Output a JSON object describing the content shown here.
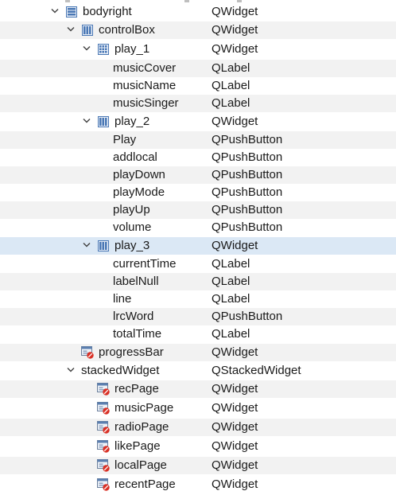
{
  "tree": {
    "rows": [
      {
        "name": "bodyright",
        "cls": "QWidget",
        "level": 0,
        "expander": "expanded",
        "icon": "vertical-layout-icon",
        "alt": false,
        "selected": false
      },
      {
        "name": "controlBox",
        "cls": "QWidget",
        "level": 1,
        "expander": "expanded",
        "icon": "horizontal-layout-icon",
        "alt": true,
        "selected": false
      },
      {
        "name": "play_1",
        "cls": "QWidget",
        "level": 2,
        "expander": "expanded",
        "icon": "grid-layout-icon",
        "alt": false,
        "selected": false
      },
      {
        "name": "musicCover",
        "cls": "QLabel",
        "level": 3,
        "expander": "none",
        "icon": "",
        "alt": true,
        "selected": false
      },
      {
        "name": "musicName",
        "cls": "QLabel",
        "level": 3,
        "expander": "none",
        "icon": "",
        "alt": false,
        "selected": false
      },
      {
        "name": "musicSinger",
        "cls": "QLabel",
        "level": 3,
        "expander": "none",
        "icon": "",
        "alt": true,
        "selected": false
      },
      {
        "name": "play_2",
        "cls": "QWidget",
        "level": 2,
        "expander": "expanded",
        "icon": "horizontal-layout-icon",
        "alt": false,
        "selected": false
      },
      {
        "name": "Play",
        "cls": "QPushButton",
        "level": 3,
        "expander": "none",
        "icon": "",
        "alt": true,
        "selected": false
      },
      {
        "name": "addlocal",
        "cls": "QPushButton",
        "level": 3,
        "expander": "none",
        "icon": "",
        "alt": false,
        "selected": false
      },
      {
        "name": "playDown",
        "cls": "QPushButton",
        "level": 3,
        "expander": "none",
        "icon": "",
        "alt": true,
        "selected": false
      },
      {
        "name": "playMode",
        "cls": "QPushButton",
        "level": 3,
        "expander": "none",
        "icon": "",
        "alt": false,
        "selected": false
      },
      {
        "name": "playUp",
        "cls": "QPushButton",
        "level": 3,
        "expander": "none",
        "icon": "",
        "alt": true,
        "selected": false
      },
      {
        "name": "volume",
        "cls": "QPushButton",
        "level": 3,
        "expander": "none",
        "icon": "",
        "alt": false,
        "selected": false
      },
      {
        "name": "play_3",
        "cls": "QWidget",
        "level": 2,
        "expander": "expanded",
        "icon": "horizontal-layout-icon",
        "alt": false,
        "selected": true
      },
      {
        "name": "currentTime",
        "cls": "QLabel",
        "level": 3,
        "expander": "none",
        "icon": "",
        "alt": false,
        "selected": false
      },
      {
        "name": "labelNull",
        "cls": "QLabel",
        "level": 3,
        "expander": "none",
        "icon": "",
        "alt": true,
        "selected": false
      },
      {
        "name": "line",
        "cls": "QLabel",
        "level": 3,
        "expander": "none",
        "icon": "",
        "alt": false,
        "selected": false
      },
      {
        "name": "lrcWord",
        "cls": "QPushButton",
        "level": 3,
        "expander": "none",
        "icon": "",
        "alt": true,
        "selected": false
      },
      {
        "name": "totalTime",
        "cls": "QLabel",
        "level": 3,
        "expander": "none",
        "icon": "",
        "alt": false,
        "selected": false
      },
      {
        "name": "progressBar",
        "cls": "QWidget",
        "level": 1,
        "expander": "none",
        "icon": "broken-layout-widget-icon",
        "alt": true,
        "selected": false
      },
      {
        "name": "stackedWidget",
        "cls": "QStackedWidget",
        "level": 1,
        "expander": "expanded",
        "icon": "",
        "alt": false,
        "selected": false
      },
      {
        "name": "recPage",
        "cls": "QWidget",
        "level": 2,
        "expander": "none",
        "icon": "broken-layout-widget-icon",
        "alt": true,
        "selected": false
      },
      {
        "name": "musicPage",
        "cls": "QWidget",
        "level": 2,
        "expander": "none",
        "icon": "broken-layout-widget-icon",
        "alt": false,
        "selected": false
      },
      {
        "name": "radioPage",
        "cls": "QWidget",
        "level": 2,
        "expander": "none",
        "icon": "broken-layout-widget-icon",
        "alt": true,
        "selected": false
      },
      {
        "name": "likePage",
        "cls": "QWidget",
        "level": 2,
        "expander": "none",
        "icon": "broken-layout-widget-icon",
        "alt": false,
        "selected": false
      },
      {
        "name": "localPage",
        "cls": "QWidget",
        "level": 2,
        "expander": "none",
        "icon": "broken-layout-widget-icon",
        "alt": true,
        "selected": false
      },
      {
        "name": "recentPage",
        "cls": "QWidget",
        "level": 2,
        "expander": "none",
        "icon": "broken-layout-widget-icon",
        "alt": false,
        "selected": false
      }
    ]
  },
  "colors": {
    "alt_row": "#f2f2f2",
    "selected_row": "#dbe8f5",
    "layout_icon_blue": "#4a78b5",
    "broken_badge_red": "#d93025"
  }
}
